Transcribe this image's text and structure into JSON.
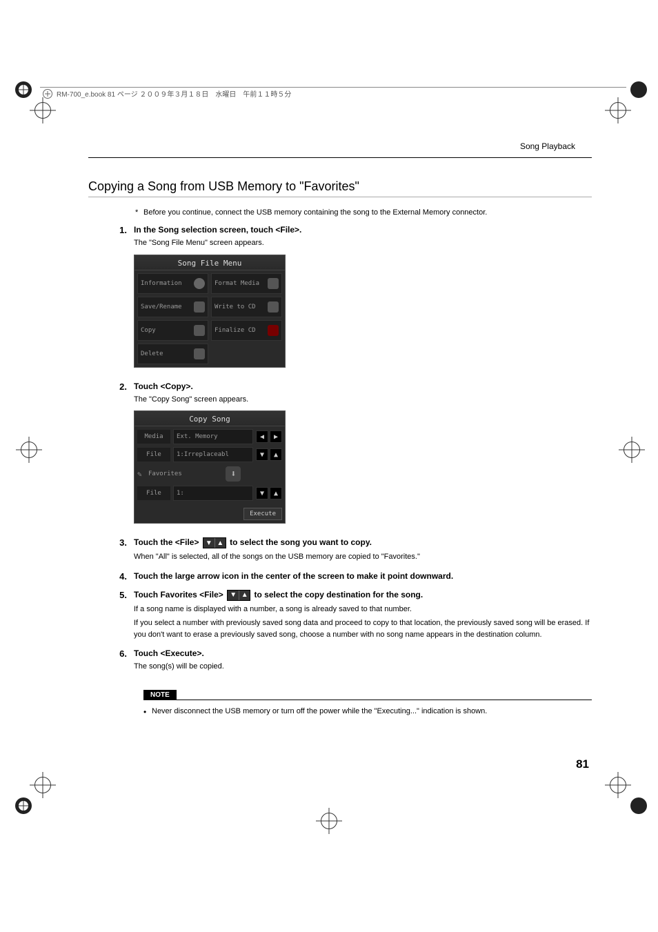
{
  "header_text": "RM-700_e.book  81 ページ  ２００９年３月１８日　水曜日　午前１１時５分",
  "section_header": "Song Playback",
  "title": "Copying a Song from USB Memory to \"Favorites\"",
  "pre_note": "Before you continue, connect the USB memory containing the song to the External Memory connector.",
  "step1": {
    "bold": "In the Song selection screen, touch <File>.",
    "plain": "The \"Song File Menu\" screen appears."
  },
  "song_file_menu": {
    "title": "Song File Menu",
    "items": [
      {
        "left": "Information",
        "right": "Format Media"
      },
      {
        "left": "Save/Rename",
        "right": "Write to CD"
      },
      {
        "left": "Copy",
        "right": "Finalize CD"
      },
      {
        "left": "Delete",
        "right": ""
      }
    ]
  },
  "step2": {
    "bold": "Touch <Copy>.",
    "plain": "The \"Copy Song\" screen appears."
  },
  "copy_song": {
    "title": "Copy Song",
    "row1_label": "Media",
    "row1_value": "Ext. Memory",
    "row2_label": "File",
    "row2_value": "1:Irreplaceabl",
    "favorites": "Favorites",
    "row3_label": "File",
    "row3_value": "1:",
    "execute": "Execute"
  },
  "step3": {
    "bold_a": "Touch the <File> ",
    "bold_b": " to select the song you want to copy.",
    "plain": "When \"All\" is selected, all of the songs on the USB memory are copied to \"Favorites.\""
  },
  "step4": {
    "bold": "Touch the large arrow icon in the center of the screen to make it point downward."
  },
  "step5": {
    "bold_a": "Touch Favorites <File> ",
    "bold_b": " to select the copy destination for the song.",
    "plain1": "If a song name is displayed with a number, a song is already saved to that number.",
    "plain2": "If you select a number with previously saved song data and proceed to copy to that location, the previously saved song will be erased. If you don't want to erase a previously saved song, choose a number with no song name appears in the destination column."
  },
  "step6": {
    "bold": "Touch <Execute>.",
    "plain": "The song(s) will be copied."
  },
  "note_label": "NOTE",
  "note_text": "Never disconnect the USB memory or turn off the power while the \"Executing...\" indication is shown.",
  "page_number": "81"
}
